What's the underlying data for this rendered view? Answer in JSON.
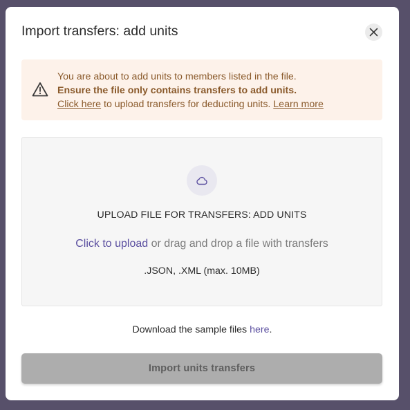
{
  "dialog": {
    "title": "Import transfers: add units",
    "close_icon": "close-icon"
  },
  "alert": {
    "icon": "warning-triangle-icon",
    "line1": "You are about to add units to members listed in the file.",
    "line2_bold": "Ensure the file only contains transfers to add units.",
    "line3_link": "Click here",
    "line3_text": " to upload transfers for deducting units. ",
    "line3_learn_more": "Learn more ",
    "colors": {
      "background": "#fdf2ea",
      "text": "#8a5a2b"
    }
  },
  "dropzone": {
    "icon": "cloud-upload-icon",
    "title": "UPLOAD FILE FOR TRANSFERS: ADD UNITS",
    "upload_link": "Click to upload",
    "upload_text": " or drag and drop a file with transfers",
    "formats": ".JSON, .XML (max. 10MB)"
  },
  "sample": {
    "prefix": "Download the sample files ",
    "link": "here",
    "suffix": "."
  },
  "footer": {
    "import_button": "Import units transfers",
    "import_button_state": "disabled"
  },
  "colors": {
    "accent": "#5a4e9f",
    "backdrop": "#57506a",
    "button_disabled": "#adadad"
  }
}
